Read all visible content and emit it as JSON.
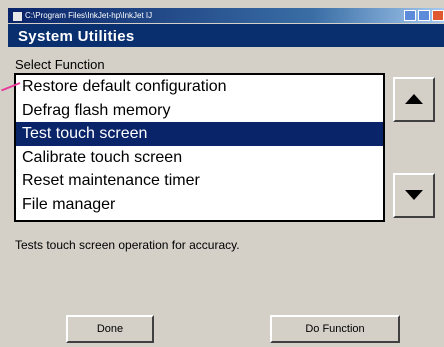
{
  "window": {
    "title": "C:\\Program Files\\InkJet-hp\\InkJet   IJ"
  },
  "header": {
    "title": "System Utilities"
  },
  "select_label": "Select Function",
  "functions": [
    {
      "label": "Restore default configuration"
    },
    {
      "label": "Defrag flash memory"
    },
    {
      "label": "Test touch screen"
    },
    {
      "label": "Calibrate touch screen"
    },
    {
      "label": "Reset maintenance timer"
    },
    {
      "label": "File manager"
    }
  ],
  "selected_index": 2,
  "description": "Tests touch screen operation for accuracy.",
  "buttons": {
    "done": "Done",
    "do_function": "Do Function"
  },
  "colors": {
    "selection": "#0a246a",
    "header": "#0a2f6f",
    "callout": "#e8399b"
  }
}
